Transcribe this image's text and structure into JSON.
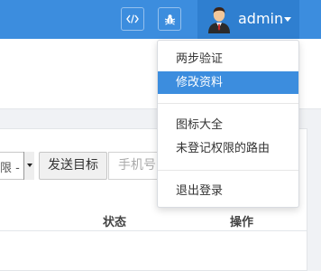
{
  "header": {
    "code_icon": "code-icon",
    "bug_icon": "bug-icon",
    "username": "admin",
    "accent_color": "#3c8dde"
  },
  "toolbar": {
    "select_value": "限 -",
    "send_button_label": "发送目标",
    "phone_placeholder": "手机号"
  },
  "table": {
    "columns": [
      "状态",
      "操作"
    ]
  },
  "user_menu": {
    "items": [
      {
        "label": "两步验证",
        "active": false
      },
      {
        "label": "修改资料",
        "active": true
      },
      {
        "label": "图标大全",
        "active": false
      },
      {
        "label": "未登记权限的路由",
        "active": false
      },
      {
        "label": "退出登录",
        "active": false
      }
    ]
  }
}
